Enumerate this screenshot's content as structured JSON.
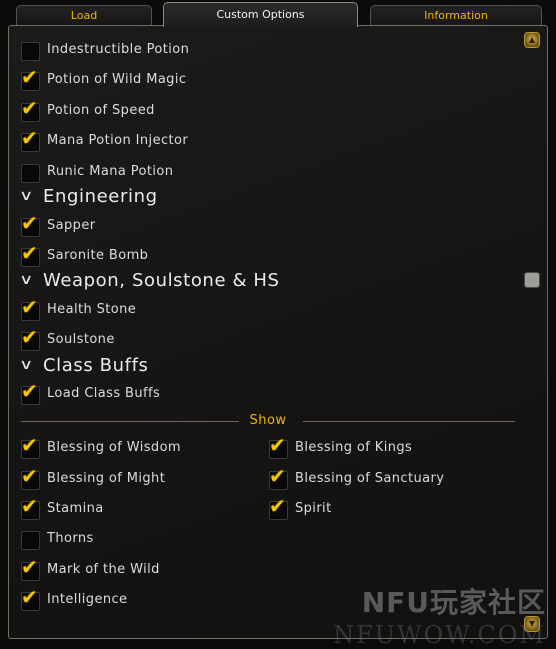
{
  "tabs": [
    {
      "label": "Load"
    },
    {
      "label": "Custom Options"
    },
    {
      "label": "Information"
    }
  ],
  "items": [
    {
      "label": "Indestructible Potion",
      "checked": false
    },
    {
      "label": "Potion of Wild Magic",
      "checked": true
    },
    {
      "label": "Potion of Speed",
      "checked": true
    },
    {
      "label": "Mana Potion Injector",
      "checked": true
    },
    {
      "label": "Runic Mana Potion",
      "checked": false
    }
  ],
  "engineering": {
    "title": "Engineering",
    "items": [
      {
        "label": "Sapper",
        "checked": true
      },
      {
        "label": "Saronite Bomb",
        "checked": true
      }
    ]
  },
  "weapon": {
    "title": "Weapon, Soulstone & HS",
    "items": [
      {
        "label": "Health Stone",
        "checked": true
      },
      {
        "label": "Soulstone",
        "checked": true
      }
    ]
  },
  "classbuffs": {
    "title": "Class Buffs",
    "items": [
      {
        "label": "Load Class Buffs",
        "checked": true
      }
    ]
  },
  "show": {
    "title": "Show",
    "left": [
      {
        "label": "Blessing of Wisdom",
        "checked": true
      },
      {
        "label": "Blessing of Might",
        "checked": true
      },
      {
        "label": "Stamina",
        "checked": true
      },
      {
        "label": "Thorns",
        "checked": false
      },
      {
        "label": "Mark of the Wild",
        "checked": true
      },
      {
        "label": "Intelligence",
        "checked": true
      }
    ],
    "right": [
      {
        "label": "Blessing of Kings",
        "checked": true
      },
      {
        "label": "Blessing of Sanctuary",
        "checked": true
      },
      {
        "label": "Spirit",
        "checked": true
      }
    ]
  },
  "scroll": {
    "position": 0.45
  },
  "watermark": {
    "line1": "NFU玩家社区",
    "line2": "NFUWOW.COM"
  },
  "colors": {
    "accent": "#e8b800",
    "check": "#f4c800",
    "text": "#dcdcdc"
  }
}
